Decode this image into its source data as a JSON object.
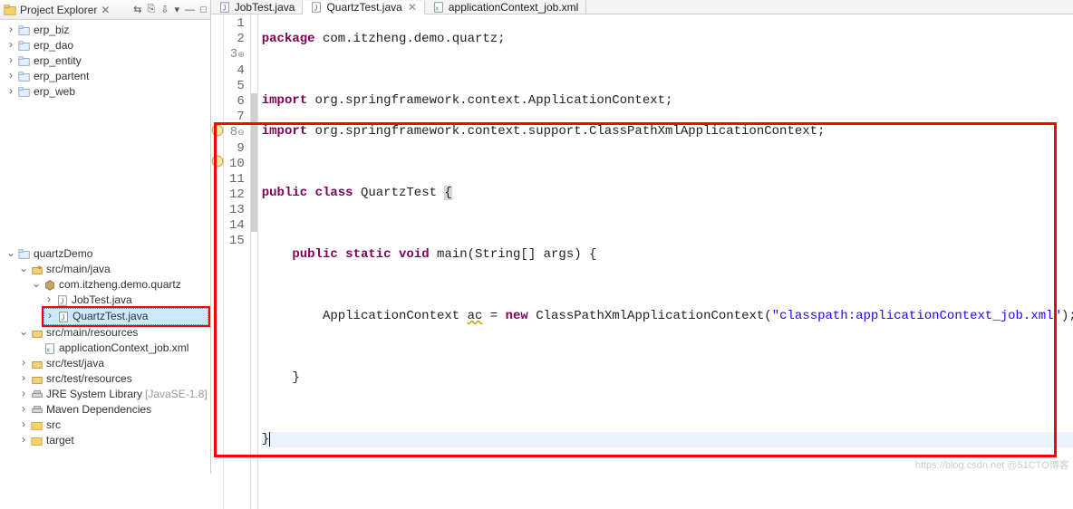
{
  "panel": {
    "title": "Project Explorer"
  },
  "toolbar": {
    "b1": "⇆",
    "b2": "⎘",
    "b3": "⇩",
    "b4": "▾",
    "b5": "—",
    "b6": "□"
  },
  "tree_top": [
    {
      "label": "erp_biz",
      "kind": "proj"
    },
    {
      "label": "erp_dao",
      "kind": "proj"
    },
    {
      "label": "erp_entity",
      "kind": "proj"
    },
    {
      "label": "erp_partent",
      "kind": "proj"
    },
    {
      "label": "erp_web",
      "kind": "proj"
    }
  ],
  "tree_main": {
    "project": "quartzDemo",
    "srcjava": "src/main/java",
    "pkg": "com.itzheng.demo.quartz",
    "files": [
      "JobTest.java",
      "QuartzTest.java"
    ],
    "srcres": "src/main/resources",
    "resfile": "applicationContext_job.xml",
    "srctestjava": "src/test/java",
    "srctestres": "src/test/resources",
    "jre": "JRE System Library",
    "jre_suffix": "[JavaSE-1.8]",
    "maven": "Maven Dependencies",
    "src": "src",
    "target": "target"
  },
  "tabs": [
    {
      "label": "JobTest.java",
      "active": false,
      "kind": "java"
    },
    {
      "label": "QuartzTest.java",
      "active": true,
      "kind": "java"
    },
    {
      "label": "applicationContext_job.xml",
      "active": false,
      "kind": "xml"
    }
  ],
  "code": {
    "l1": {
      "pre": "",
      "kw": "package",
      "rest": " com.itzheng.demo.quartz;"
    },
    "l2": "",
    "l3": {
      "pre": "",
      "kw": "import",
      "rest": " org.springframework.context.ApplicationContext;"
    },
    "l4": {
      "pre": "",
      "kw": "import",
      "rest": " org.springframework.context.support.ClassPathXmlApplicationContext;"
    },
    "l5": "",
    "l6": {
      "pre": "",
      "kw1": "public",
      "kw2": "class",
      "name": " QuartzTest ",
      "brace": "{"
    },
    "l7": "",
    "l8": {
      "indent": "    ",
      "kw1": "public",
      "kw2": "static",
      "kw3": "void",
      "name": " main(String[] args) {",
      "brace": ""
    },
    "l9": "",
    "l10": {
      "indent": "        ",
      "t1": "ApplicationContext ",
      "warn": "ac",
      "t2": " = ",
      "kw": "new",
      "t3": " ClassPathXmlApplicationContext(",
      "str": "\"classpath:applicationContext_job.xml\"",
      "t4": ");"
    },
    "l11": "",
    "l12": "    }",
    "l13": "",
    "l14": "}",
    "l15": ""
  },
  "watermark": "https://blog.csdn.net @51CTO博客"
}
